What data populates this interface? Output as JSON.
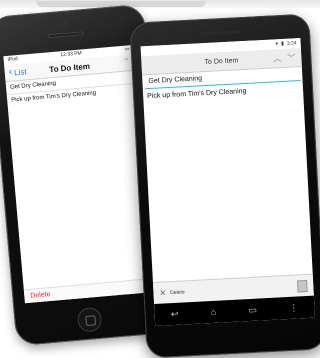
{
  "banner": {
    "label": ""
  },
  "ios": {
    "status_left": "iPod",
    "status_time": "12:33 PM",
    "back_label": "List",
    "title": "To Do Item",
    "item_title": "Get Dry Cleaning",
    "item_notes": "Pick up from Tim's Dry Cleaning",
    "delete_label": "Delete",
    "icons": {
      "back": "chevron-left-icon",
      "up": "chevron-up-icon"
    }
  },
  "android": {
    "status_time": "3:24",
    "title": "To Do Item",
    "item_title": "Get Dry Cleaning",
    "item_notes": "Pick up from Tim's Dry Cleaning",
    "delete_label": "Delete",
    "icons": {
      "up": "chevron-up-icon",
      "down": "chevron-down-icon",
      "delete": "close-icon",
      "notes": "note-icon",
      "back": "back-icon",
      "home": "home-icon",
      "recent": "recent-apps-icon",
      "menu": "menu-icon"
    }
  },
  "colors": {
    "ios_accent": "#1a7bff",
    "ios_delete": "#e0302a",
    "android_accent": "#33b5e5"
  }
}
